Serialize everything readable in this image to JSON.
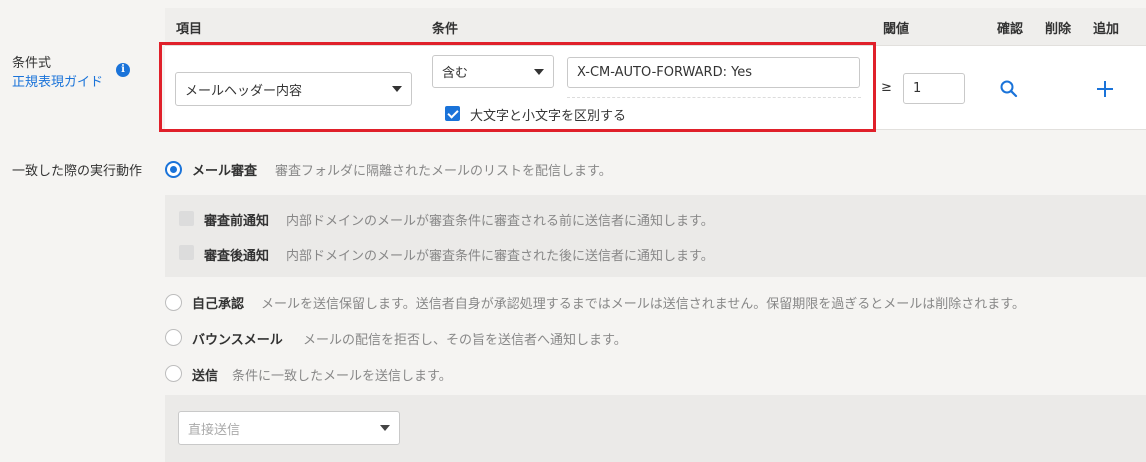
{
  "left_labels": {
    "condition": "条件式",
    "guide_link": "正規表現ガイド",
    "action": "一致した際の実行動作"
  },
  "table_headers": {
    "item": "項目",
    "condition": "条件",
    "threshold": "閾値",
    "confirm": "確認",
    "delete": "削除",
    "add": "追加"
  },
  "condition_row": {
    "item_select": "メールヘッダー内容",
    "operator_select": "含む",
    "value_input": "X-CM-AUTO-FORWARD: Yes",
    "case_sensitive_label": "大文字と小文字を区別する",
    "case_sensitive_checked": true,
    "ge_symbol": "≥",
    "threshold_value": "1"
  },
  "actions": [
    {
      "label": "メール審査",
      "desc": "審査フォルダに隔離されたメールのリストを配信します。",
      "selected": true
    },
    {
      "label": "自己承認",
      "desc": "メールを送信保留します。送信者自身が承認処理するまではメールは送信されません。保留期限を過ぎるとメールは削除されます。",
      "selected": false
    },
    {
      "label": "バウンスメール",
      "desc": "メールの配信を拒否し、その旨を送信者へ通知します。",
      "selected": false
    },
    {
      "label": "送信",
      "desc": "条件に一致したメールを送信します。",
      "selected": false
    }
  ],
  "review_options": [
    {
      "label": "審査前通知",
      "desc": "内部ドメインのメールが審査条件に審査される前に送信者に通知します。"
    },
    {
      "label": "審査後通知",
      "desc": "内部ドメインのメールが審査条件に審査された後に送信者に通知します。"
    }
  ],
  "send_select": "直接送信",
  "colors": {
    "accent": "#1a73d9",
    "highlight": "#e0202a"
  }
}
